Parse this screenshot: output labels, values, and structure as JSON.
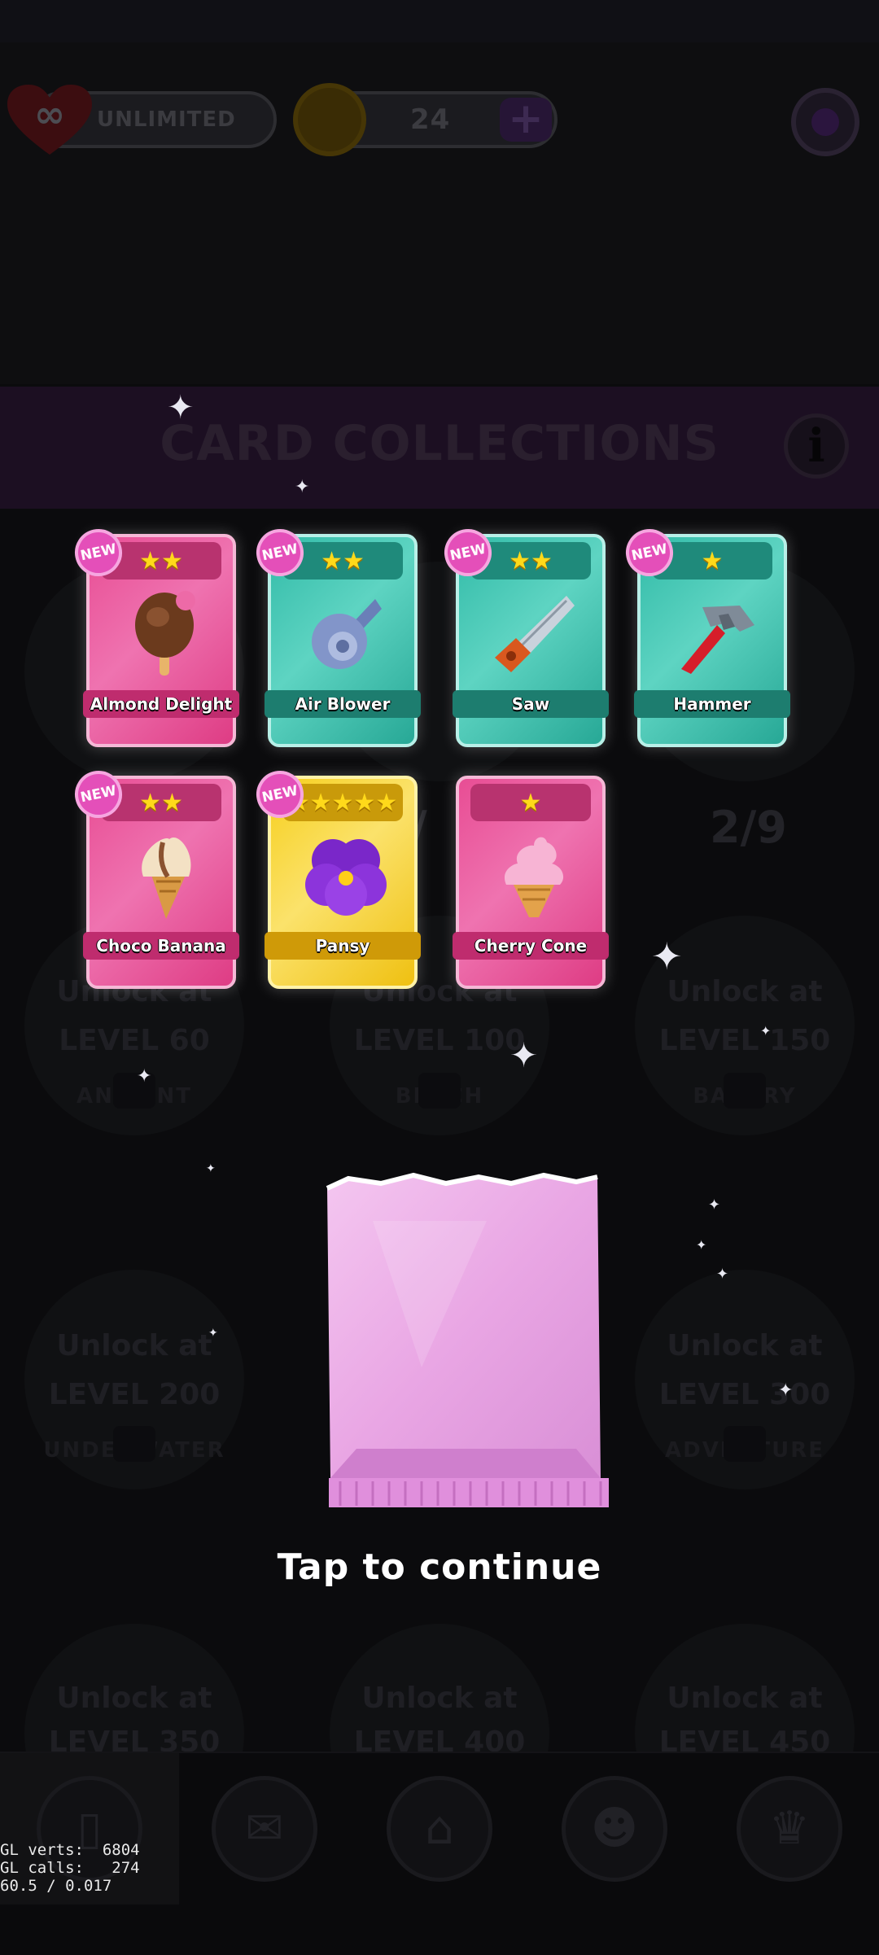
{
  "hud": {
    "lives_label": "UNLIMITED",
    "coins": "24",
    "plus_label": "+"
  },
  "screen": {
    "title": "CARD COLLECTIONS",
    "info_label": "i",
    "ghost_progress_left": "/",
    "ghost_progress_right": "2/9",
    "locked_albums": [
      {
        "line1": "Unlock at",
        "line2": "LEVEL 60",
        "name": "ANCIENT"
      },
      {
        "line1": "Unlock at",
        "line2": "LEVEL 100",
        "name": "BEACH"
      },
      {
        "line1": "Unlock at",
        "line2": "LEVEL 150",
        "name": "BAKERY"
      },
      {
        "line1": "Unlock at",
        "line2": "LEVEL 200",
        "name": "UNDERWATER"
      },
      {
        "line1": "Unlock at",
        "line2": "LEVEL 300",
        "name": "ADVENTURE"
      },
      {
        "line1": "Unlock at",
        "line2": "LEVEL 350",
        "name": ""
      },
      {
        "line1": "Unlock at",
        "line2": "LEVEL 400",
        "name": ""
      },
      {
        "line1": "Unlock at",
        "line2": "LEVEL 450",
        "name": ""
      }
    ]
  },
  "cards": [
    {
      "name": "Almond Delight",
      "stars": 2,
      "stars_text": "★★",
      "is_new": true,
      "new_label": "NEW",
      "color": "pink",
      "art": "ice-cream-bar-icon"
    },
    {
      "name": "Air Blower",
      "stars": 2,
      "stars_text": "★★",
      "is_new": true,
      "new_label": "NEW",
      "color": "teal",
      "art": "air-blower-icon"
    },
    {
      "name": "Saw",
      "stars": 2,
      "stars_text": "★★",
      "is_new": true,
      "new_label": "NEW",
      "color": "teal",
      "art": "saw-icon"
    },
    {
      "name": "Hammer",
      "stars": 1,
      "stars_text": "★",
      "is_new": true,
      "new_label": "NEW",
      "color": "teal",
      "art": "hammer-icon"
    },
    {
      "name": "Choco Banana",
      "stars": 2,
      "stars_text": "★★",
      "is_new": true,
      "new_label": "NEW",
      "color": "pink",
      "art": "ice-cream-cone-icon"
    },
    {
      "name": "Pansy",
      "stars": 5,
      "stars_text": "★★★★★",
      "is_new": true,
      "new_label": "NEW",
      "color": "gold",
      "art": "pansy-flower-icon"
    },
    {
      "name": "Cherry Cone",
      "stars": 1,
      "stars_text": "★",
      "is_new": false,
      "new_label": "",
      "color": "pink",
      "art": "soft-serve-cone-icon"
    }
  ],
  "prompt": "Tap to continue",
  "debug": {
    "line1": "GL verts:  6804",
    "line2": "GL calls:   274",
    "line3": "60.5 / 0.017"
  },
  "colors": {
    "pink_card": "#e84d94",
    "teal_card": "#32bba8",
    "gold_card": "#f6cf1e",
    "new_badge": "#e44fb9",
    "pack": "#e9a6e4"
  }
}
